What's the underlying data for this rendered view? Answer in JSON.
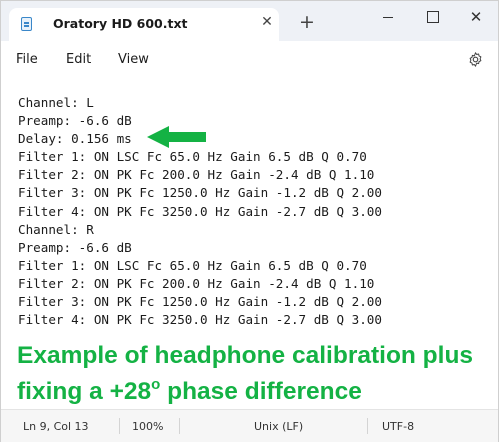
{
  "window": {
    "tab_title": "Oratory HD 600.txt",
    "tab_close_glyph": "✕",
    "new_tab_glyph": "+",
    "close_glyph": "✕"
  },
  "menu": {
    "file": "File",
    "edit": "Edit",
    "view": "View"
  },
  "editor": {
    "lines": [
      "Channel: L",
      "Preamp: -6.6 dB",
      "Delay: 0.156 ms",
      "Filter 1: ON LSC Fc 65.0 Hz Gain 6.5 dB Q 0.70",
      "Filter 2: ON PK Fc 200.0 Hz Gain -2.4 dB Q 1.10",
      "Filter 3: ON PK Fc 1250.0 Hz Gain -1.2 dB Q 2.00",
      "Filter 4: ON PK Fc 3250.0 Hz Gain -2.7 dB Q 3.00",
      "Channel: R",
      "Preamp: -6.6 dB",
      "Filter 1: ON LSC Fc 65.0 Hz Gain 6.5 dB Q 0.70",
      "Filter 2: ON PK Fc 200.0 Hz Gain -2.4 dB Q 1.10",
      "Filter 3: ON PK Fc 1250.0 Hz Gain -1.2 dB Q 2.00",
      "Filter 4: ON PK Fc 3250.0 Hz Gain -2.7 dB Q 3.00"
    ]
  },
  "annotation": {
    "caption_line1": "Example of headphone calibration plus",
    "caption_line2_prefix": "fixing a +28",
    "caption_degree": "o",
    "caption_line2_suffix": " phase difference",
    "arrow_color": "#14b244"
  },
  "status": {
    "position": "Ln 9, Col 13",
    "zoom": "100%",
    "line_ending": "Unix (LF)",
    "encoding": "UTF-8"
  },
  "icons": [
    "notepad-document-icon",
    "close-icon",
    "plus-icon",
    "minimize-icon",
    "maximize-icon",
    "gear-icon",
    "arrow-left-icon"
  ]
}
